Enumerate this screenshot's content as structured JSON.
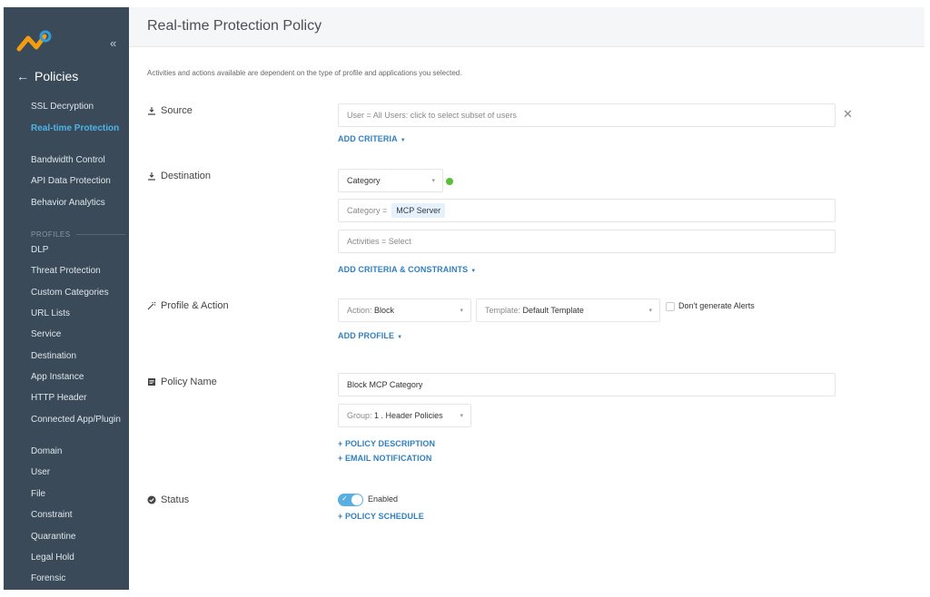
{
  "sidebar": {
    "back_label": "Policies",
    "items": [
      {
        "label": "SSL Decryption"
      },
      {
        "label": "Real-time Protection"
      },
      {
        "label": "Bandwidth Control"
      },
      {
        "label": "API Data Protection"
      },
      {
        "label": "Behavior Analytics"
      }
    ],
    "profiles_header": "PROFILES",
    "profiles": [
      {
        "label": "DLP"
      },
      {
        "label": "Threat Protection"
      },
      {
        "label": "Custom Categories"
      },
      {
        "label": "URL Lists"
      },
      {
        "label": "Service"
      },
      {
        "label": "Destination"
      },
      {
        "label": "App Instance"
      },
      {
        "label": "HTTP Header"
      },
      {
        "label": "Connected App/Plugin"
      },
      {
        "label": "Domain"
      },
      {
        "label": "User"
      },
      {
        "label": "File"
      },
      {
        "label": "Constraint"
      },
      {
        "label": "Quarantine"
      },
      {
        "label": "Legal Hold"
      },
      {
        "label": "Forensic"
      }
    ],
    "active_index": 1
  },
  "header": {
    "title": "Real-time Protection Policy"
  },
  "info_text": "Activities and actions available are dependent on the type of profile and applications you selected.",
  "source": {
    "label": "Source",
    "user_field": "User = All Users: click to select subset of users",
    "add_criteria": "ADD CRITERIA"
  },
  "destination": {
    "label": "Destination",
    "type_select": "Category",
    "category_prefix": "Category =",
    "category_chip": "MCP Server",
    "activities_field": "Activities = Select",
    "add_criteria": "ADD CRITERIA & CONSTRAINTS"
  },
  "profile_action": {
    "label": "Profile & Action",
    "action_prefix": "Action:",
    "action_value": "Block",
    "template_prefix": "Template:",
    "template_value": "Default Template",
    "no_alerts_label": "Don't generate Alerts",
    "add_profile": "ADD PROFILE"
  },
  "policy_name": {
    "label": "Policy Name",
    "value": "Block MCP Category",
    "group_prefix": "Group:",
    "group_value": "1 . Header Policies",
    "description_link": "+ POLICY DESCRIPTION",
    "email_link": "+ EMAIL NOTIFICATION"
  },
  "status": {
    "label": "Status",
    "toggle_label": "Enabled",
    "schedule_link": "+ POLICY SCHEDULE"
  },
  "colors": {
    "sidebar_bg": "#3a4a58",
    "accent": "#2f7fc1",
    "active_nav": "#4fb3e8",
    "status_dot": "#5bbd3a",
    "toggle_on": "#5aaee0"
  }
}
